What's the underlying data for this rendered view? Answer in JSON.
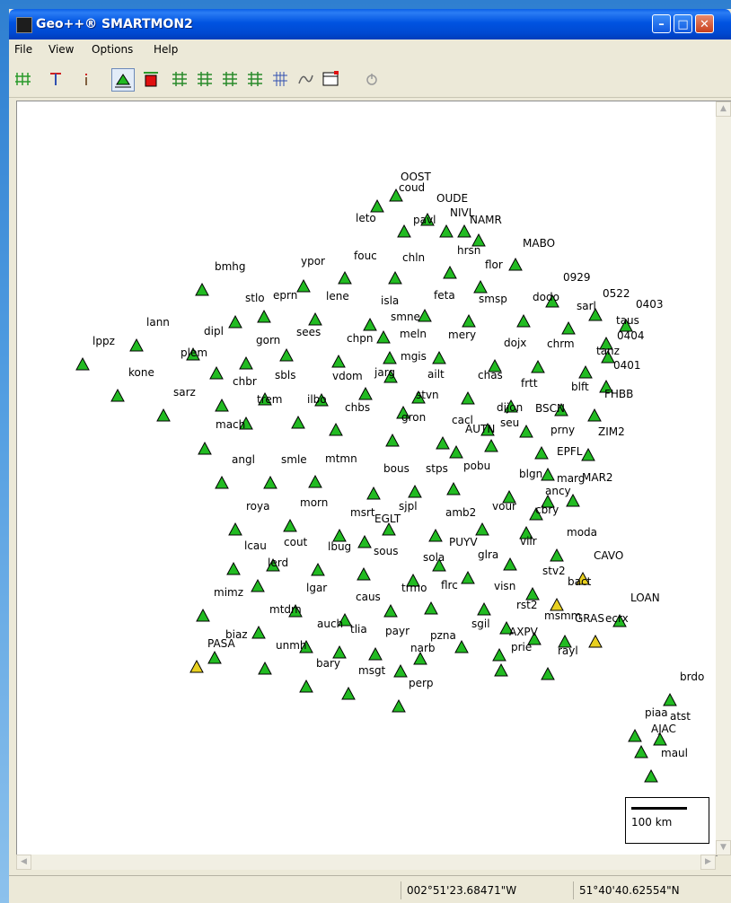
{
  "window": {
    "title": "Geo++® SMARTMON2",
    "controls": {
      "minimize": "–",
      "maximize": "□",
      "close": "✕"
    }
  },
  "menu": [
    "File",
    "View",
    "Options",
    "Help"
  ],
  "toolbar": {
    "tools": [
      "grid-icon",
      "signal-t-icon",
      "info-icon",
      "station-map-icon",
      "station-red-icon",
      "layer-1-icon",
      "layer-2-icon",
      "layer-3-icon",
      "layer-4-icon",
      "grid-lines-icon",
      "curve-icon",
      "table-icon",
      "power-icon"
    ]
  },
  "map": {
    "scale_label": "100 km",
    "stations": [
      {
        "label": "OOST",
        "status": "green"
      },
      {
        "label": "coud",
        "status": "green"
      },
      {
        "label": "OUDE",
        "status": "green"
      },
      {
        "label": "leto",
        "status": "green"
      },
      {
        "label": "pavl",
        "status": "green"
      },
      {
        "label": "NIVL",
        "status": "green"
      },
      {
        "label": "NAMR",
        "status": "green"
      },
      {
        "label": "MABO",
        "status": "green"
      },
      {
        "label": "hrsn",
        "status": "green"
      },
      {
        "label": "fouc",
        "status": "green"
      },
      {
        "label": "chln",
        "status": "green"
      },
      {
        "label": "ypor",
        "status": "green"
      },
      {
        "label": "flor",
        "status": "green"
      },
      {
        "label": "bmhg",
        "status": "green"
      },
      {
        "label": "0929",
        "status": "green"
      },
      {
        "label": "0522",
        "status": "green"
      },
      {
        "label": "0403",
        "status": "green"
      },
      {
        "label": "stlo",
        "status": "green"
      },
      {
        "label": "eprn",
        "status": "green"
      },
      {
        "label": "lene",
        "status": "green"
      },
      {
        "label": "isla",
        "status": "green"
      },
      {
        "label": "feta",
        "status": "green"
      },
      {
        "label": "smsp",
        "status": "green"
      },
      {
        "label": "dodo",
        "status": "green"
      },
      {
        "label": "sarl",
        "status": "green"
      },
      {
        "label": "taus",
        "status": "green"
      },
      {
        "label": "lann",
        "status": "green"
      },
      {
        "label": "smne",
        "status": "green"
      },
      {
        "label": "dipl",
        "status": "green"
      },
      {
        "label": "sees",
        "status": "green"
      },
      {
        "label": "meln",
        "status": "green"
      },
      {
        "label": "mery",
        "status": "green"
      },
      {
        "label": "0404",
        "status": "green"
      },
      {
        "label": "lppz",
        "status": "green"
      },
      {
        "label": "gorn",
        "status": "green"
      },
      {
        "label": "chpn",
        "status": "green"
      },
      {
        "label": "dojx",
        "status": "green"
      },
      {
        "label": "chrm",
        "status": "green"
      },
      {
        "label": "tanz",
        "status": "green"
      },
      {
        "label": "plem",
        "status": "green"
      },
      {
        "label": "mgis",
        "status": "green"
      },
      {
        "label": "0401",
        "status": "green"
      },
      {
        "label": "kone",
        "status": "green"
      },
      {
        "label": "sbls",
        "status": "green"
      },
      {
        "label": "vdom",
        "status": "green"
      },
      {
        "label": "jarg",
        "status": "green"
      },
      {
        "label": "ailt",
        "status": "green"
      },
      {
        "label": "chas",
        "status": "green"
      },
      {
        "label": "chbr",
        "status": "green"
      },
      {
        "label": "frtt",
        "status": "green"
      },
      {
        "label": "blft",
        "status": "green"
      },
      {
        "label": "sarz",
        "status": "green"
      },
      {
        "label": "stvn",
        "status": "green"
      },
      {
        "label": "FHBB",
        "status": "green"
      },
      {
        "label": "chbs",
        "status": "green"
      },
      {
        "label": "dijon",
        "status": "green"
      },
      {
        "label": "BSCN",
        "status": "green"
      },
      {
        "label": "trem",
        "status": "green"
      },
      {
        "label": "ilbo",
        "status": "green"
      },
      {
        "label": "gron",
        "status": "green"
      },
      {
        "label": "cacl",
        "status": "green"
      },
      {
        "label": "seu",
        "status": "green"
      },
      {
        "label": "mach",
        "status": "green"
      },
      {
        "label": "AUTN",
        "status": "green"
      },
      {
        "label": "prny",
        "status": "green"
      },
      {
        "label": "ZIM2",
        "status": "green"
      },
      {
        "label": "EPFL",
        "status": "green"
      },
      {
        "label": "angl",
        "status": "green"
      },
      {
        "label": "smle",
        "status": "green"
      },
      {
        "label": "mtmn",
        "status": "green"
      },
      {
        "label": "bous",
        "status": "green"
      },
      {
        "label": "stps",
        "status": "green"
      },
      {
        "label": "pobu",
        "status": "green"
      },
      {
        "label": "blgn",
        "status": "green"
      },
      {
        "label": "marg",
        "status": "green"
      },
      {
        "label": "MAR2",
        "status": "green"
      },
      {
        "label": "ancy",
        "status": "green"
      },
      {
        "label": "royа",
        "status": "green"
      },
      {
        "label": "morn",
        "status": "green"
      },
      {
        "label": "sjpl",
        "status": "green"
      },
      {
        "label": "msrt",
        "status": "green"
      },
      {
        "label": "EGLT",
        "status": "green"
      },
      {
        "label": "amb2",
        "status": "green"
      },
      {
        "label": "vour",
        "status": "green"
      },
      {
        "label": "cbry",
        "status": "green"
      },
      {
        "label": "moda",
        "status": "green"
      },
      {
        "label": "lcau",
        "status": "green"
      },
      {
        "label": "cout",
        "status": "green"
      },
      {
        "label": "lbug",
        "status": "green"
      },
      {
        "label": "PUYV",
        "status": "green"
      },
      {
        "label": "vilr",
        "status": "green"
      },
      {
        "label": "CAVO",
        "status": "yellow"
      },
      {
        "label": "sous",
        "status": "green"
      },
      {
        "label": "glra",
        "status": "green"
      },
      {
        "label": "lerd",
        "status": "green"
      },
      {
        "label": "sola",
        "status": "green"
      },
      {
        "label": "stv2",
        "status": "green"
      },
      {
        "label": "bact",
        "status": "yellow"
      },
      {
        "label": "mimz",
        "status": "green"
      },
      {
        "label": "lgar",
        "status": "green"
      },
      {
        "label": "trmo",
        "status": "green"
      },
      {
        "label": "flrc",
        "status": "green"
      },
      {
        "label": "visn",
        "status": "green"
      },
      {
        "label": "caus",
        "status": "green"
      },
      {
        "label": "LOAN",
        "status": "green"
      },
      {
        "label": "rst2",
        "status": "green"
      },
      {
        "label": "mtdm",
        "status": "green"
      },
      {
        "label": "msmm",
        "status": "green"
      },
      {
        "label": "GRAS",
        "status": "green"
      },
      {
        "label": "ecrx",
        "status": "yellow"
      },
      {
        "label": "auch",
        "status": "green"
      },
      {
        "label": "tlia",
        "status": "green"
      },
      {
        "label": "sgil",
        "status": "green"
      },
      {
        "label": "AXPV",
        "status": "green"
      },
      {
        "label": "payr",
        "status": "green"
      },
      {
        "label": "pzna",
        "status": "green"
      },
      {
        "label": "biaz",
        "status": "green"
      },
      {
        "label": "PASA",
        "status": "yellow"
      },
      {
        "label": "unmh",
        "status": "green"
      },
      {
        "label": "narb",
        "status": "green"
      },
      {
        "label": "prie",
        "status": "green"
      },
      {
        "label": "rayl",
        "status": "green"
      },
      {
        "label": "bary",
        "status": "green"
      },
      {
        "label": "msgt",
        "status": "green"
      },
      {
        "label": "perp",
        "status": "green"
      },
      {
        "label": "brdo",
        "status": "green"
      },
      {
        "label": "piaa",
        "status": "green"
      },
      {
        "label": "atst",
        "status": "green"
      },
      {
        "label": "AJAC",
        "status": "green"
      },
      {
        "label": "maul",
        "status": "green"
      }
    ]
  },
  "status": {
    "longitude": "002°51'23.68471\"W",
    "latitude": "51°40'40.62554\"N"
  },
  "colors": {
    "station_ok": "#22bb22",
    "station_warn": "#e8d020",
    "titlebar": "#0053e1"
  }
}
